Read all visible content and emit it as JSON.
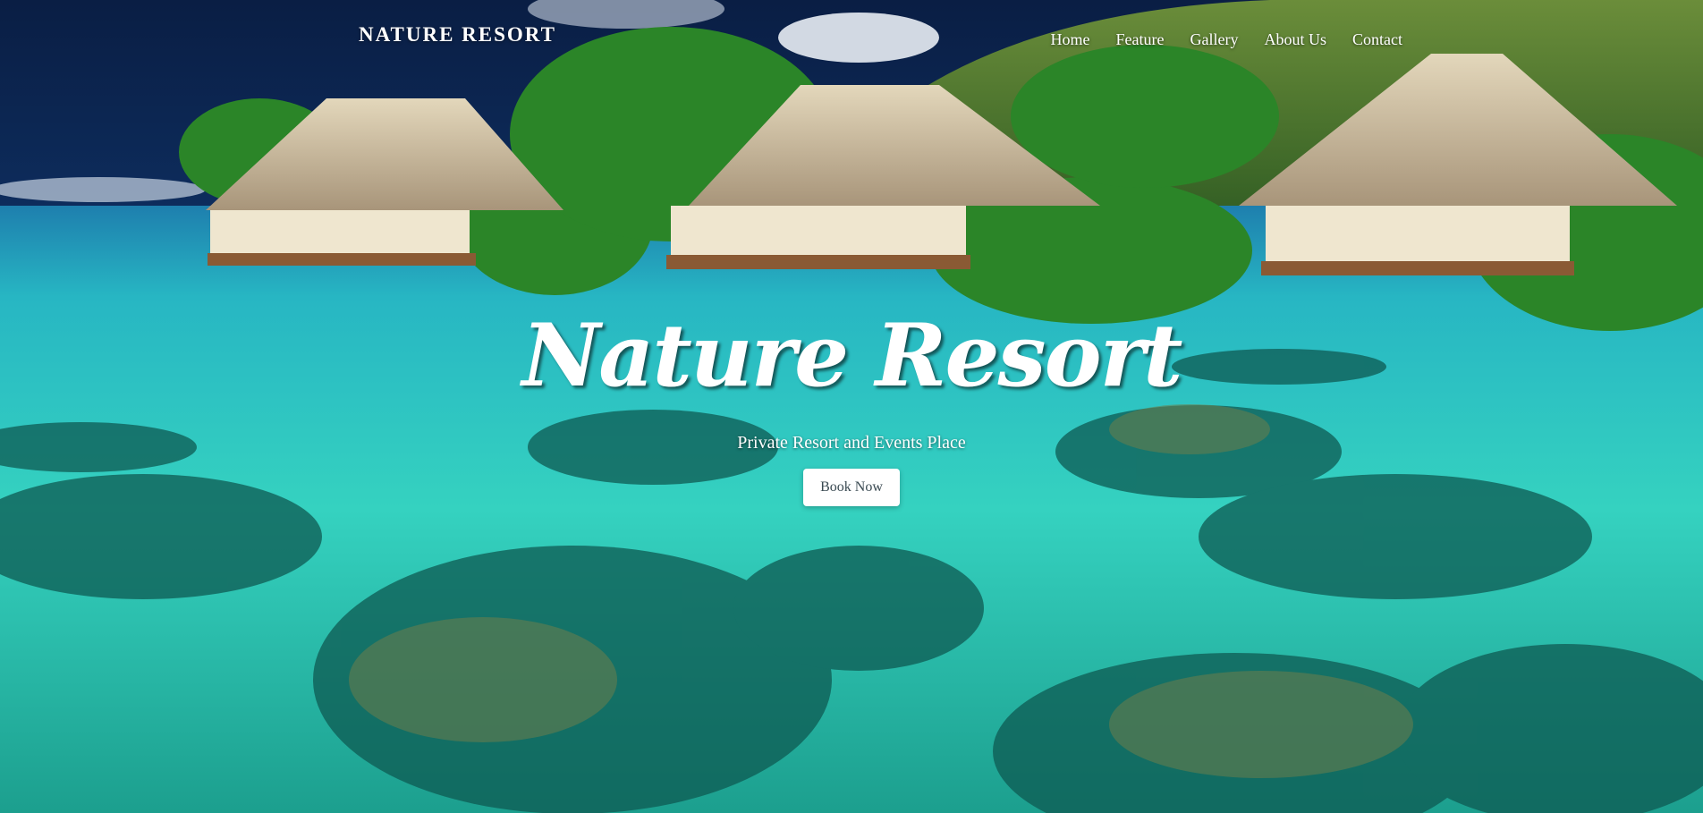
{
  "header": {
    "brand": "NATURE RESORT",
    "nav": [
      "Home",
      "Feature",
      "Gallery",
      "About Us",
      "Contact"
    ]
  },
  "hero": {
    "headline": "Nature Resort",
    "tagline": "Private Resort and Events Place",
    "cta_label": "Book Now"
  },
  "colors": {
    "sky": "#0d2f66",
    "water": "#2fd0c0",
    "deep_water": "#0b6f78",
    "foliage": "#2f8a2a",
    "thatch": "#c9b896"
  }
}
